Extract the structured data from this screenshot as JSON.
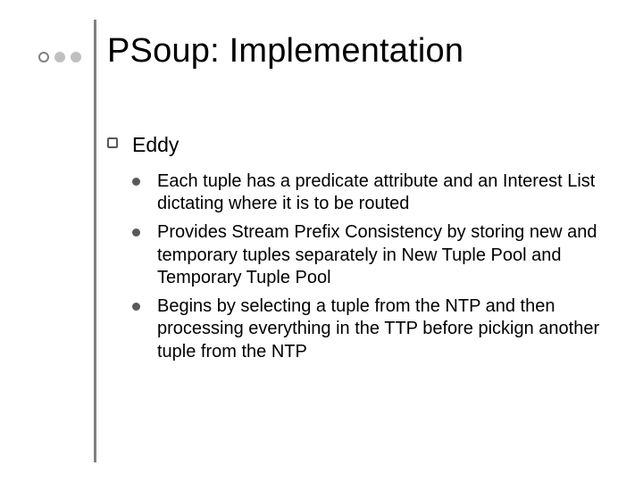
{
  "slide": {
    "title": "PSoup: Implementation",
    "lvl1": {
      "text": "Eddy"
    },
    "lvl2": [
      {
        "text": "Each tuple has a predicate attribute and an Interest List dictating where it is to be routed"
      },
      {
        "text": "Provides Stream Prefix Consistency by storing new and temporary tuples separately in New Tuple Pool and Temporary Tuple Pool"
      },
      {
        "text": "Begins by selecting a tuple from the NTP and then processing everything in the TTP before pickign another tuple from the NTP"
      }
    ]
  }
}
